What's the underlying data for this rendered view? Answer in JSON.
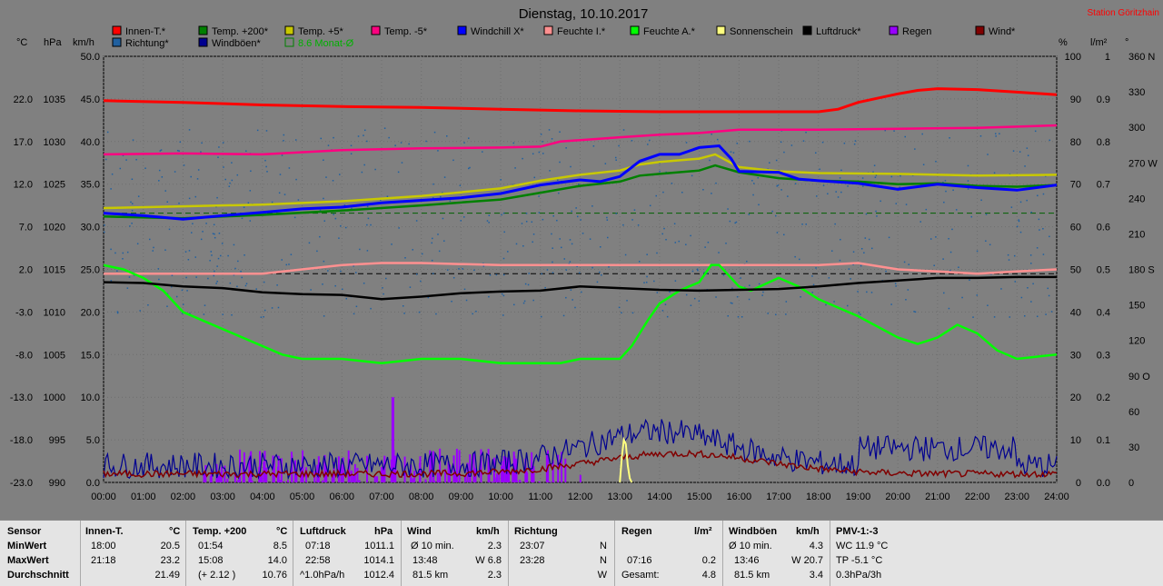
{
  "title": "Dienstag, 10.10.2017",
  "station": "Station Göritzhain",
  "colors": {
    "background": "#808080",
    "bottom_bg": "#e4e4e4",
    "axis": "#000000"
  },
  "legend": [
    {
      "name": "Innen-T.*",
      "color": "#ff0000"
    },
    {
      "name": "Temp. +200*",
      "color": "#008000"
    },
    {
      "name": "Temp. +5*",
      "color": "#c8c800"
    },
    {
      "name": "Temp. -5*",
      "color": "#ff0080"
    },
    {
      "name": "Windchill X*",
      "color": "#0000ff"
    },
    {
      "name": "Feuchte I.*",
      "color": "#ff9090"
    },
    {
      "name": "Feuchte A.*",
      "color": "#00ff00"
    },
    {
      "name": "Sonnenschein",
      "color": "#ffff80"
    },
    {
      "name": "Luftdruck*",
      "color": "#000000"
    },
    {
      "name": "Regen",
      "color": "#9900ff"
    },
    {
      "name": "Wind*",
      "color": "#800000"
    },
    {
      "name": "Richtung*",
      "color": "#2060a0"
    },
    {
      "name": "Windböen*",
      "color": "#000090"
    },
    {
      "name": "8.6 Monat-Ø",
      "color": "#008000",
      "dashed": true
    }
  ],
  "axis_units": {
    "temp": "°C",
    "press": "hPa",
    "wind": "km/h",
    "hum": "%",
    "rain": "l/m²",
    "dir": "°"
  },
  "axis_ticks": {
    "temp": [
      "22.0",
      "17.0",
      "12.0",
      "7.0",
      "2.0",
      "-3.0",
      "-8.0",
      "-13.0",
      "-18.0",
      "-23.0"
    ],
    "press": [
      "1035",
      "1030",
      "1025",
      "1020",
      "1015",
      "1010",
      "1005",
      "1000",
      "995",
      "990"
    ],
    "wind": [
      "50.0",
      "45.0",
      "40.0",
      "35.0",
      "30.0",
      "25.0",
      "20.0",
      "15.0",
      "10.0",
      "5.0",
      "0.0"
    ],
    "hum": [
      "100",
      "90",
      "80",
      "70",
      "60",
      "50",
      "40",
      "30",
      "20",
      "10",
      "0"
    ],
    "rain": [
      "1",
      "0.9",
      "0.8",
      "0.7",
      "0.6",
      "0.5",
      "0.4",
      "0.3",
      "0.2",
      "0.1",
      "0.0"
    ],
    "dir": [
      "360 N",
      "330",
      "300",
      "270 W",
      "240",
      "210",
      "180 S",
      "150",
      "120",
      "90 O",
      "60",
      "30",
      "0"
    ],
    "x": [
      "00:00",
      "01:00",
      "02:00",
      "03:00",
      "04:00",
      "05:00",
      "06:00",
      "07:00",
      "08:00",
      "09:00",
      "10:00",
      "11:00",
      "12:00",
      "13:00",
      "14:00",
      "15:00",
      "16:00",
      "17:00",
      "18:00",
      "19:00",
      "20:00",
      "21:00",
      "22:00",
      "23:00",
      "24:00"
    ]
  },
  "chart_data": {
    "type": "line",
    "title": "Dienstag, 10.10.2017",
    "xlim": [
      0,
      24
    ],
    "temp_ylim": [
      -23,
      27
    ],
    "hum_ylim": [
      0,
      100
    ],
    "wind_ylim": [
      0,
      50
    ],
    "series": [
      {
        "name": "Innen-T.*",
        "axis": "temp",
        "points": [
          [
            0,
            21.8
          ],
          [
            2,
            21.6
          ],
          [
            4,
            21.3
          ],
          [
            6,
            21.1
          ],
          [
            8,
            21.0
          ],
          [
            10,
            20.8
          ],
          [
            12,
            20.6
          ],
          [
            14,
            20.5
          ],
          [
            16,
            20.5
          ],
          [
            17,
            20.5
          ],
          [
            18,
            20.5
          ],
          [
            18.5,
            20.8
          ],
          [
            19,
            21.6
          ],
          [
            20,
            22.6
          ],
          [
            20.5,
            23.0
          ],
          [
            21,
            23.2
          ],
          [
            22,
            23.1
          ],
          [
            23,
            22.8
          ],
          [
            24,
            22.5
          ]
        ]
      },
      {
        "name": "Temp. -5*",
        "axis": "temp",
        "points": [
          [
            0,
            15.5
          ],
          [
            2,
            15.6
          ],
          [
            4,
            15.5
          ],
          [
            6,
            16.0
          ],
          [
            8,
            16.2
          ],
          [
            10,
            16.3
          ],
          [
            11,
            16.4
          ],
          [
            11.5,
            17.0
          ],
          [
            13,
            17.5
          ],
          [
            14,
            17.8
          ],
          [
            15,
            18.0
          ],
          [
            16,
            18.4
          ],
          [
            18,
            18.4
          ],
          [
            20,
            18.5
          ],
          [
            22,
            18.6
          ],
          [
            24,
            18.9
          ]
        ]
      },
      {
        "name": "Temp. +5*",
        "axis": "temp",
        "points": [
          [
            0,
            9.2
          ],
          [
            2,
            9.4
          ],
          [
            4,
            9.6
          ],
          [
            6,
            10.0
          ],
          [
            8,
            10.6
          ],
          [
            10,
            11.5
          ],
          [
            11,
            12.4
          ],
          [
            12,
            13.1
          ],
          [
            13,
            13.6
          ],
          [
            13.5,
            14.3
          ],
          [
            14,
            14.6
          ],
          [
            15,
            15.0
          ],
          [
            15.4,
            15.5
          ],
          [
            16,
            14.0
          ],
          [
            17,
            13.5
          ],
          [
            18,
            13.3
          ],
          [
            20,
            13.2
          ],
          [
            22,
            13.0
          ],
          [
            24,
            13.1
          ]
        ]
      },
      {
        "name": "Temp. +200*",
        "axis": "temp",
        "points": [
          [
            0,
            8.2
          ],
          [
            2,
            8.0
          ],
          [
            4,
            8.4
          ],
          [
            6,
            8.9
          ],
          [
            8,
            9.5
          ],
          [
            10,
            10.2
          ],
          [
            11,
            11.0
          ],
          [
            12,
            11.8
          ],
          [
            13,
            12.3
          ],
          [
            13.5,
            13.0
          ],
          [
            14,
            13.2
          ],
          [
            15,
            13.6
          ],
          [
            15.4,
            14.2
          ],
          [
            16,
            13.4
          ],
          [
            17,
            12.7
          ],
          [
            18,
            12.4
          ],
          [
            19,
            12.3
          ],
          [
            20,
            12.0
          ],
          [
            21,
            12.1
          ],
          [
            22,
            11.8
          ],
          [
            23,
            11.7
          ],
          [
            24,
            11.9
          ]
        ]
      },
      {
        "name": "Windchill X*",
        "axis": "temp",
        "points": [
          [
            0,
            8.6
          ],
          [
            1,
            8.3
          ],
          [
            2,
            7.9
          ],
          [
            3,
            8.3
          ],
          [
            4,
            8.7
          ],
          [
            5,
            9.1
          ],
          [
            6,
            9.3
          ],
          [
            7,
            9.8
          ],
          [
            8,
            10.1
          ],
          [
            9,
            10.4
          ],
          [
            10,
            10.9
          ],
          [
            11,
            11.9
          ],
          [
            12,
            12.5
          ],
          [
            12.5,
            12.3
          ],
          [
            13,
            12.9
          ],
          [
            13.5,
            14.7
          ],
          [
            14,
            15.5
          ],
          [
            14.5,
            15.5
          ],
          [
            15,
            16.3
          ],
          [
            15.5,
            16.5
          ],
          [
            15.8,
            15.0
          ],
          [
            16,
            13.5
          ],
          [
            17,
            13.4
          ],
          [
            17.5,
            12.6
          ],
          [
            18,
            12.4
          ],
          [
            19,
            12.1
          ],
          [
            20,
            11.4
          ],
          [
            21,
            12.0
          ],
          [
            22,
            11.6
          ],
          [
            23,
            11.3
          ],
          [
            24,
            11.9
          ]
        ]
      },
      {
        "name": "Feuchte I.*",
        "axis": "hum",
        "points": [
          [
            0,
            49
          ],
          [
            2,
            49
          ],
          [
            4,
            49
          ],
          [
            5,
            50
          ],
          [
            6,
            51
          ],
          [
            7,
            51.5
          ],
          [
            8,
            51.5
          ],
          [
            10,
            51
          ],
          [
            11,
            51
          ],
          [
            13,
            51
          ],
          [
            15,
            51
          ],
          [
            16,
            51
          ],
          [
            18,
            51
          ],
          [
            19,
            51.5
          ],
          [
            20,
            50
          ],
          [
            21,
            49.5
          ],
          [
            22,
            49
          ],
          [
            23,
            49.5
          ],
          [
            24,
            50
          ]
        ]
      },
      {
        "name": "Feuchte A.*",
        "axis": "hum",
        "points": [
          [
            0,
            51
          ],
          [
            0.5,
            50
          ],
          [
            1,
            48
          ],
          [
            1.5,
            45
          ],
          [
            2,
            40
          ],
          [
            3,
            36
          ],
          [
            4,
            32
          ],
          [
            4.5,
            30
          ],
          [
            5,
            29
          ],
          [
            6,
            29
          ],
          [
            7,
            28
          ],
          [
            8,
            29
          ],
          [
            9,
            29
          ],
          [
            10,
            28
          ],
          [
            11,
            28
          ],
          [
            11.5,
            28
          ],
          [
            12,
            29
          ],
          [
            13,
            29
          ],
          [
            13.3,
            32
          ],
          [
            13.7,
            38
          ],
          [
            14,
            42
          ],
          [
            14.5,
            45
          ],
          [
            15,
            47
          ],
          [
            15.3,
            51
          ],
          [
            15.5,
            51
          ],
          [
            16,
            46
          ],
          [
            16.3,
            45
          ],
          [
            17,
            48
          ],
          [
            17.5,
            46
          ],
          [
            18,
            43
          ],
          [
            19,
            39
          ],
          [
            20,
            34
          ],
          [
            20.5,
            32.5
          ],
          [
            21,
            34
          ],
          [
            21.5,
            37
          ],
          [
            22,
            35
          ],
          [
            22.5,
            31
          ],
          [
            23,
            29
          ],
          [
            23.5,
            29.5
          ],
          [
            24,
            30
          ]
        ]
      },
      {
        "name": "Luftdruck*",
        "axis": "press",
        "points": [
          [
            0,
            1013.5
          ],
          [
            1,
            1013.4
          ],
          [
            2,
            1013.0
          ],
          [
            3,
            1012.8
          ],
          [
            4,
            1012.3
          ],
          [
            5,
            1012.1
          ],
          [
            6,
            1012.0
          ],
          [
            7,
            1011.5
          ],
          [
            8,
            1011.8
          ],
          [
            9,
            1012.2
          ],
          [
            10,
            1012.4
          ],
          [
            11,
            1012.5
          ],
          [
            12,
            1013.0
          ],
          [
            13,
            1012.8
          ],
          [
            14,
            1012.6
          ],
          [
            15,
            1012.5
          ],
          [
            16,
            1012.6
          ],
          [
            17,
            1012.7
          ],
          [
            18,
            1013.0
          ],
          [
            19,
            1013.4
          ],
          [
            20,
            1013.7
          ],
          [
            21,
            1014.0
          ],
          [
            22,
            1014.0
          ],
          [
            23,
            1014.1
          ],
          [
            24,
            1014.1
          ]
        ]
      }
    ],
    "monthly_avg": {
      "name": "8.6 Monat-Ø",
      "value": 8.6
    }
  },
  "summary": {
    "sensor": {
      "label": "Sensor",
      "min": "MinWert",
      "max": "MaxWert",
      "avg": "Durchschnitt"
    },
    "innen": {
      "head": "Innen-T.",
      "unit": "°C",
      "min_time": "18:00",
      "min": "20.5",
      "max_time": "21:18",
      "max": "23.2",
      "avg": "21.49"
    },
    "temp200": {
      "head": "Temp. +200",
      "unit": "°C",
      "min_time": "01:54",
      "min": "8.5",
      "max_time": "15:08",
      "max": "14.0",
      "avg_note": "(+ 2.12 )",
      "avg": "10.76"
    },
    "druck": {
      "head": "Luftdruck",
      "unit": "hPa",
      "min_time": "07:18",
      "min": "1011.1",
      "max_time": "22:58",
      "max": "1014.1",
      "avg_note": "^1.0hPa/h",
      "avg": "1012.4"
    },
    "wind": {
      "head": "Wind",
      "unit": "km/h",
      "min_label": "Ø 10 min.",
      "min": "2.3",
      "max_time": "13:48",
      "max": "W 6.8",
      "avg_note": "81.5 km",
      "avg": "2.3"
    },
    "richtung": {
      "head": "Richtung",
      "min_time": "23:07",
      "min": "N",
      "max_time": "23:28",
      "max": "N",
      "avg": "W"
    },
    "regen": {
      "head": "Regen",
      "unit": "l/m²",
      "max_time": "07:16",
      "max": "0.2",
      "avg_label": "Gesamt:",
      "avg": "4.8"
    },
    "boeen": {
      "head": "Windböen",
      "unit": "km/h",
      "min_label": "Ø 10 min.",
      "min": "4.3",
      "max_time": "13:46",
      "max": "W 20.7",
      "avg_note": "81.5 km",
      "avg": "3.4"
    },
    "pmv": {
      "head": "PMV-1:-3",
      "min": "WC 11.9 °C",
      "max": "TP -5.1 °C",
      "avg": "0.3hPa/3h"
    }
  }
}
